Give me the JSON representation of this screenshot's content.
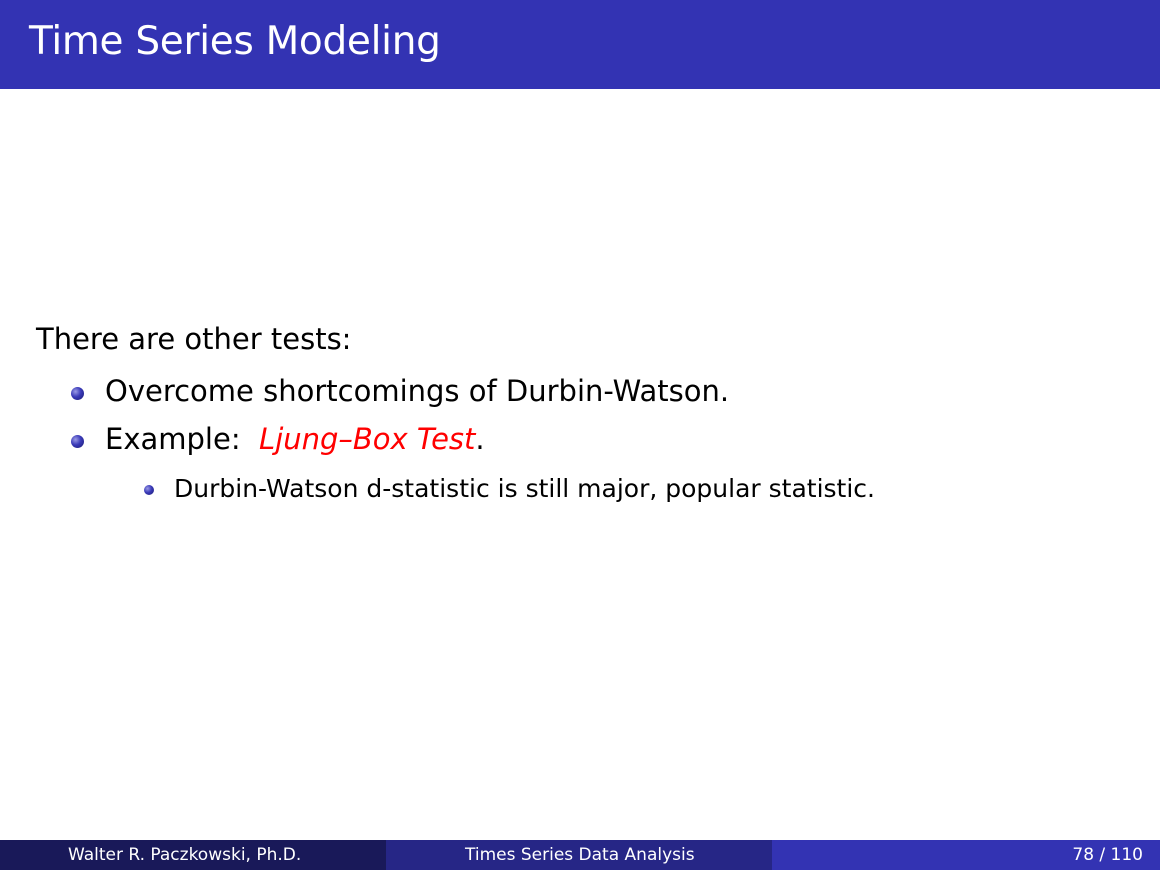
{
  "slide": {
    "title": "Time Series Modeling",
    "intro": "There are other tests:",
    "bullets": [
      {
        "text": "Overcome shortcomings of Durbin-Watson."
      },
      {
        "prefix": "Example:  ",
        "highlight": "Ljung–Box Test",
        "suffix": "."
      }
    ],
    "sub_bullets": [
      {
        "text": "Durbin-Watson d-statistic is still major, popular statistic."
      }
    ]
  },
  "footer": {
    "author": "Walter R. Paczkowski, Ph.D.",
    "course": "Times Series Data Analysis",
    "page": "78 / 110"
  },
  "colors": {
    "title_bar": "#3333b3",
    "highlight": "#ff0000",
    "footer_left": "#191959",
    "footer_mid": "#262686",
    "footer_right": "#3333b3"
  }
}
